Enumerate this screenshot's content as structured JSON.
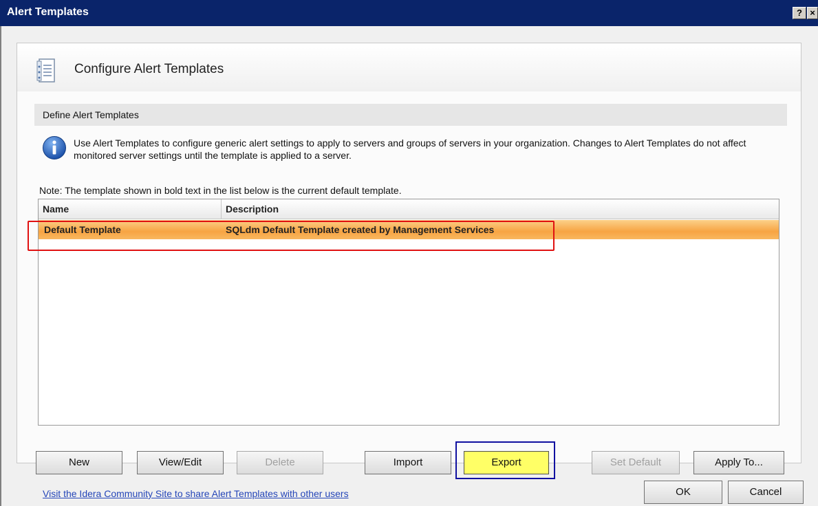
{
  "window": {
    "title": "Alert Templates",
    "help_label": "?",
    "close_label": "×"
  },
  "header": {
    "title": "Configure Alert Templates",
    "icon": "template-list-icon"
  },
  "section": {
    "title": "Define Alert Templates"
  },
  "info": {
    "icon": "info-icon",
    "text": "Use Alert Templates to configure generic alert settings to apply to servers and groups of servers in your organization.  Changes to Alert Templates do not affect monitored server settings until the template is applied to a server."
  },
  "note": "Note:  The template shown in bold text in the list below is the current default template.",
  "grid": {
    "columns": [
      "Name",
      "Description"
    ],
    "rows": [
      {
        "name": "Default Template",
        "description": "SQLdm Default Template created by Management Services"
      }
    ]
  },
  "buttons": {
    "new": "New",
    "view_edit": "View/Edit",
    "delete": "Delete",
    "import": "Import",
    "export": "Export",
    "set_default": "Set Default",
    "apply_to": "Apply To...",
    "ok": "OK",
    "cancel": "Cancel"
  },
  "footer_link": "Visit the Idera Community Site to share Alert Templates with other users",
  "colors": {
    "selected_row": "#f7a443",
    "export_highlight": "#ffff66",
    "annotation_red": "#e01010",
    "annotation_blue": "#1010a0"
  }
}
